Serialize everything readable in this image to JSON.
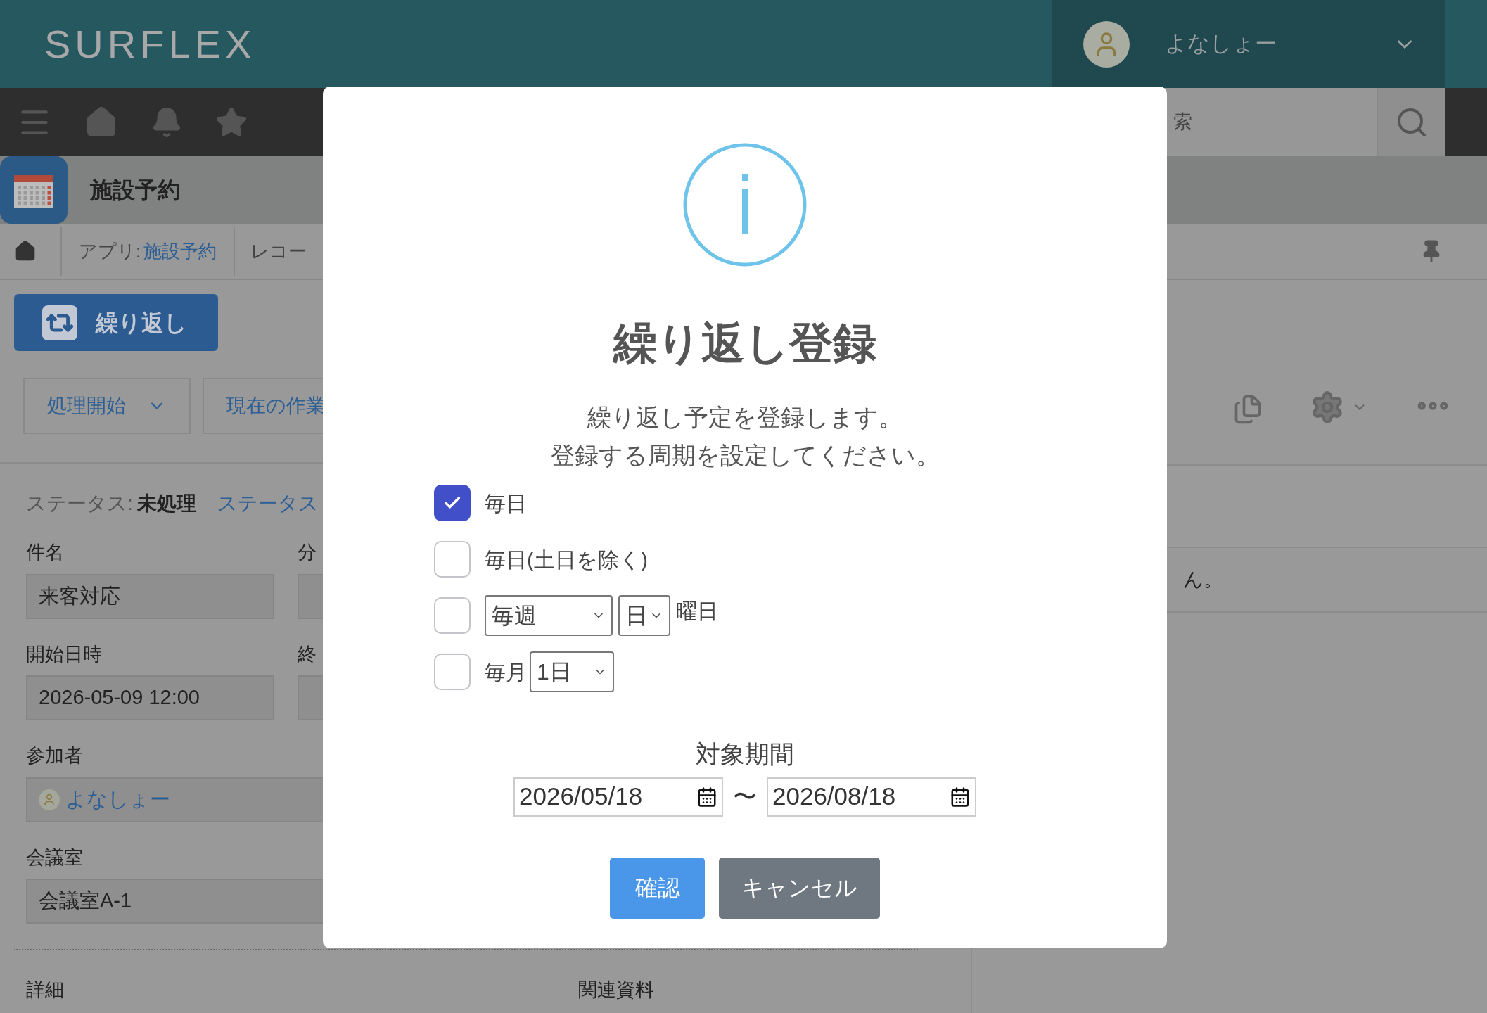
{
  "header": {
    "logo": "SURFLEX",
    "user_name": "よなしょー"
  },
  "toolbar": {
    "search_placeholder": "索"
  },
  "app_bar": {
    "title": "施設予約"
  },
  "breadcrumb": {
    "prefix": "アプリ:",
    "link": "施設予約",
    "current": "レコー"
  },
  "repeat_button": "繰り返し",
  "process_buttons": [
    "処理開始",
    "現在の作業"
  ],
  "status": {
    "label": "ステータス:",
    "value": "未処理",
    "link": "ステータス"
  },
  "fields": [
    {
      "kind": "text",
      "label": "件名",
      "value": "来客対応"
    },
    {
      "kind": "text",
      "label": "分"
    },
    {
      "kind": "text",
      "label": "開始日時",
      "value": "2026-05-09 12:00"
    },
    {
      "kind": "text",
      "label": "終"
    },
    {
      "kind": "user",
      "label": "参加者",
      "value": "よなしょー"
    },
    {
      "kind": "text",
      "label": "会議室",
      "value": "会議室A-1"
    }
  ],
  "section_labels": [
    "詳細",
    "関連資料"
  ],
  "side_panel": {
    "text": "ん。"
  },
  "modal": {
    "title": "繰り返し登録",
    "message": [
      "繰り返し予定を登録します。",
      "登録する周期を設定してください。"
    ],
    "options": [
      {
        "kind": "plain",
        "checked": true,
        "label": "毎日"
      },
      {
        "kind": "plain",
        "checked": false,
        "label": "毎日(土日を除く)"
      },
      {
        "kind": "weekly",
        "checked": false,
        "select": "毎週",
        "day": "日",
        "suffix": "曜日"
      },
      {
        "kind": "monthly",
        "checked": false,
        "label": "毎月",
        "select": "1日"
      }
    ],
    "period_label": "対象期間",
    "start_date": "2026/05/18",
    "separator": "〜",
    "end_date": "2026/08/18",
    "buttons": [
      {
        "kind": "primary",
        "label": "確認"
      },
      {
        "kind": "secondary",
        "label": "キャンセル"
      }
    ]
  }
}
